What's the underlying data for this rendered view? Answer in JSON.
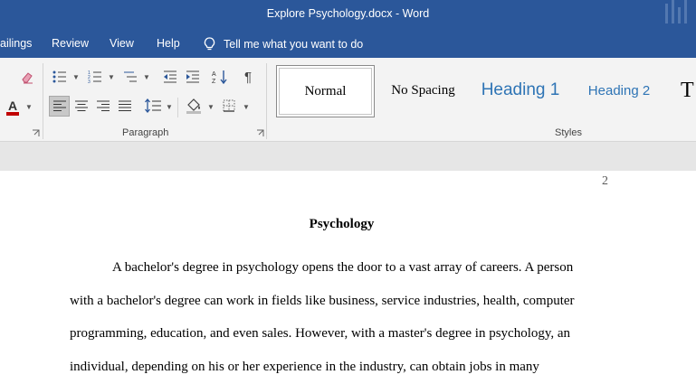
{
  "window": {
    "title": "Explore Psychology.docx  -  Word"
  },
  "tabs": [
    {
      "label": "ailings"
    },
    {
      "label": "Review"
    },
    {
      "label": "View"
    },
    {
      "label": "Help"
    }
  ],
  "tell_me": {
    "placeholder": "Tell me what you want to do",
    "icon": "lightbulb-icon"
  },
  "ribbon": {
    "groups": {
      "paragraph": "Paragraph",
      "styles": "Styles"
    },
    "styles": [
      {
        "label": "Normal",
        "selected": true
      },
      {
        "label": "No Spacing"
      },
      {
        "label": "Heading 1"
      },
      {
        "label": "Heading 2"
      },
      {
        "label": "T"
      }
    ],
    "accent_color": "#2b579a",
    "font_color_swatch": "#c00000",
    "heading_color": "#2e74b5"
  },
  "document": {
    "page_number": "2",
    "title": "Psychology",
    "lines": [
      "A bachelor's degree in psychology opens the door to a vast array of careers. A person",
      "with a bachelor's degree can work in fields like business, service industries, health, computer",
      "programming, education, and even sales. However, with a master's degree in psychology, an",
      "individual, depending on his or her experience in the industry, can obtain jobs in many"
    ]
  }
}
